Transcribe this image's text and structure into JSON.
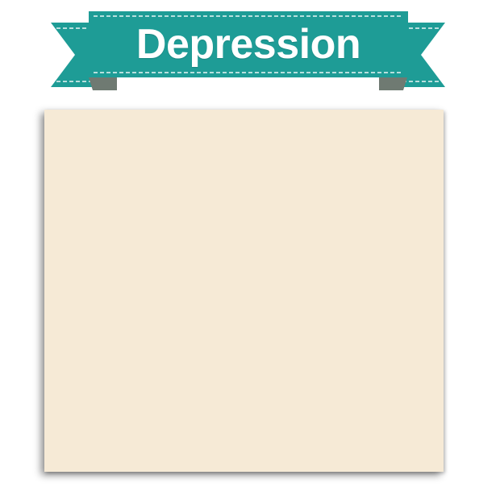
{
  "banner": {
    "title": "Depression",
    "color": "#1e9c96",
    "fold_color": "#6f7a72",
    "stitch_color": "#ffffff"
  },
  "card": {
    "background": "#f6ead6"
  }
}
